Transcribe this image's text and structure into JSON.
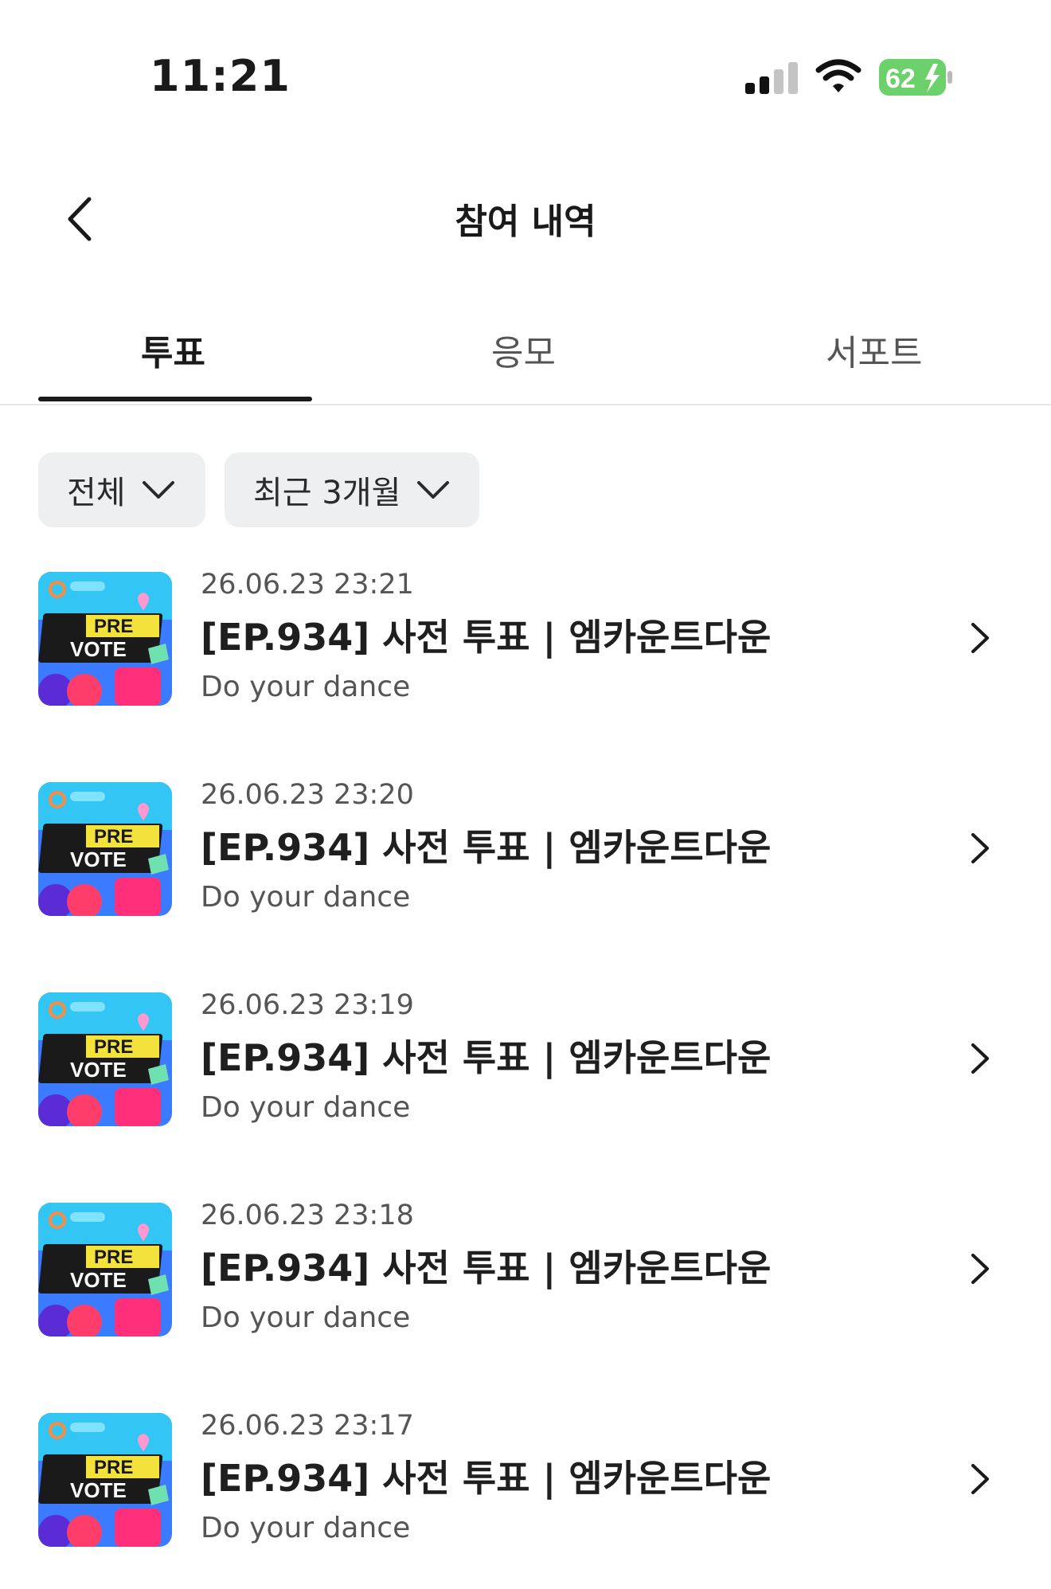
{
  "status": {
    "time": "11:21",
    "battery": "62"
  },
  "header": {
    "title": "참여 내역"
  },
  "tabs": [
    {
      "label": "투표",
      "active": true
    },
    {
      "label": "응모",
      "active": false
    },
    {
      "label": "서포트",
      "active": false
    }
  ],
  "filters": {
    "type": "전체",
    "period": "최근 3개월"
  },
  "thumbnail": {
    "line1": "PRE",
    "line2": "VOTE"
  },
  "items": [
    {
      "date": "26.06.23 23:21",
      "title": "[EP.934] 사전 투표 | 엠카운트다운",
      "subtitle": "Do your dance"
    },
    {
      "date": "26.06.23 23:20",
      "title": "[EP.934] 사전 투표 | 엠카운트다운",
      "subtitle": "Do your dance"
    },
    {
      "date": "26.06.23 23:19",
      "title": "[EP.934] 사전 투표 | 엠카운트다운",
      "subtitle": "Do your dance"
    },
    {
      "date": "26.06.23 23:18",
      "title": "[EP.934] 사전 투표 | 엠카운트다운",
      "subtitle": "Do your dance"
    },
    {
      "date": "26.06.23 23:17",
      "title": "[EP.934] 사전 투표 | 엠카운트다운",
      "subtitle": "Do your dance"
    }
  ],
  "colors": {
    "battery": "#6cd16a",
    "chip_bg": "#eeeff1",
    "indicator": "#1a1a1a"
  }
}
